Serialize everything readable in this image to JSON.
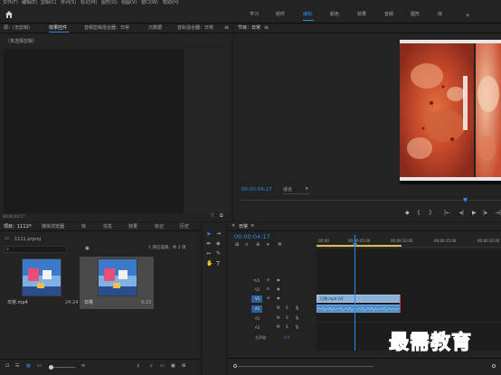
{
  "menu": [
    "文件(F)",
    "编辑(E)",
    "剪辑(C)",
    "序列(S)",
    "标记(M)",
    "图形(G)",
    "视图(V)",
    "窗口(W)",
    "帮助(H)"
  ],
  "workspaces": [
    "学习",
    "组件",
    "编辑",
    "颜色",
    "效果",
    "音频",
    "图形",
    "库"
  ],
  "active_workspace": "编辑",
  "source_tabs": [
    "源：(无剪辑)",
    "效果控件",
    "音频剪辑混合器：日常",
    "元数据",
    "音轨混合器：日常"
  ],
  "source_active_tab": "效果控件",
  "no_clip_text": "（未选择剪辑）",
  "source_timecode": "00:00:04:17",
  "program": {
    "title": "节目：日常",
    "timecode": "00:00:04:17",
    "fit": "适合",
    "accent": "#2d8ceb"
  },
  "project": {
    "tabs": [
      "项目：1111",
      "媒体浏览器",
      "库",
      "信息",
      "效果",
      "标记",
      "历史"
    ],
    "filename": "1111.prproj",
    "search_placeholder": "",
    "selection_info": "1 项已选择，共 2 项",
    "items": [
      {
        "name": "日常.mp4",
        "duration": "24:24"
      },
      {
        "name": "日常",
        "duration": "9:23"
      }
    ]
  },
  "tools": [
    "selection-tool",
    "track-select-tool",
    "ripple-edit-tool",
    "razor-tool",
    "slip-tool",
    "pen-tool",
    "hand-tool",
    "type-tool"
  ],
  "timeline": {
    "tab": "日常",
    "timecode": "00:00:04:17",
    "ruler": [
      ":00:00",
      "00:00:05:00",
      "00:00:10:00",
      "00:00:15:00",
      "00:00:20:00"
    ],
    "video_tracks": [
      "V3",
      "V2",
      "V1"
    ],
    "audio_tracks": [
      "A1",
      "A2",
      "A3"
    ],
    "master": "主声道",
    "master_value": "0.0",
    "clip_label": "日常.mp4 [V]",
    "clip_color": "#8cb1d9",
    "audio_color": "#4e8fcb"
  },
  "watermark": "最需教育"
}
